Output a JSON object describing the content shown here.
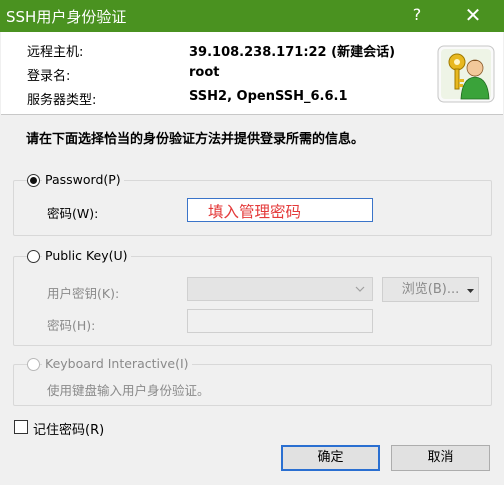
{
  "window": {
    "title": "SSH用户身份验证",
    "help_glyph": "?",
    "close_glyph": "✕"
  },
  "info": {
    "host_label": "远程主机:",
    "host_value": "39.108.238.171:22 (新建会话)",
    "user_label": "登录名:",
    "user_value": "root",
    "server_label": "服务器类型:",
    "server_value": "SSH2, OpenSSH_6.6.1",
    "avatar_icon": "user-key-icon"
  },
  "instruction": "请在下面选择恰当的身份验证方法并提供登录所需的信息。",
  "password": {
    "option_label": "Password(P)",
    "checked": true,
    "field_label": "密码(W):",
    "field_value": "填入管理密码"
  },
  "public_key": {
    "option_label": "Public Key(U)",
    "checked": false,
    "key_label": "用户密钥(K):",
    "browse_label": "浏览(B)...",
    "passphrase_label": "密码(H):"
  },
  "keyboard": {
    "option_label": "Keyboard Interactive(I)",
    "description": "使用键盘输入用户身份验证。"
  },
  "remember": {
    "label": "记住密码(R)",
    "checked": false
  },
  "buttons": {
    "ok": "确定",
    "cancel": "取消"
  },
  "colors": {
    "titlebar": "#4a9220",
    "password_text": "#e43a3a",
    "default_button_border": "#2a6fd1"
  }
}
